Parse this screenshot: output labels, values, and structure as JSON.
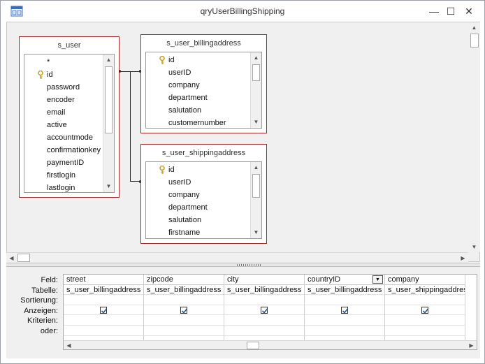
{
  "window": {
    "title": "qryUserBillingShipping",
    "minimize_glyph": "—",
    "maximize_glyph": "☐",
    "close_glyph": "✕"
  },
  "tables": [
    {
      "title": "s_user",
      "fields": [
        {
          "name": "*",
          "key": false
        },
        {
          "name": "id",
          "key": true
        },
        {
          "name": "password",
          "key": false
        },
        {
          "name": "encoder",
          "key": false
        },
        {
          "name": "email",
          "key": false
        },
        {
          "name": "active",
          "key": false
        },
        {
          "name": "accountmode",
          "key": false
        },
        {
          "name": "confirmationkey",
          "key": false
        },
        {
          "name": "paymentID",
          "key": false
        },
        {
          "name": "firstlogin",
          "key": false
        },
        {
          "name": "lastlogin",
          "key": false
        }
      ]
    },
    {
      "title": "s_user_billingaddress",
      "fields": [
        {
          "name": "id",
          "key": true
        },
        {
          "name": "userID",
          "key": false
        },
        {
          "name": "company",
          "key": false
        },
        {
          "name": "department",
          "key": false
        },
        {
          "name": "salutation",
          "key": false
        },
        {
          "name": "customernumber",
          "key": false
        }
      ]
    },
    {
      "title": "s_user_shippingaddress",
      "fields": [
        {
          "name": "id",
          "key": true
        },
        {
          "name": "userID",
          "key": false
        },
        {
          "name": "company",
          "key": false
        },
        {
          "name": "department",
          "key": false
        },
        {
          "name": "salutation",
          "key": false
        },
        {
          "name": "firstname",
          "key": false
        }
      ]
    }
  ],
  "grid": {
    "row_labels": [
      "Feld:",
      "Tabelle:",
      "Sortierung:",
      "Anzeigen:",
      "Kriterien:",
      "oder:"
    ],
    "columns": [
      {
        "feld": "street",
        "tabelle": "s_user_billingaddress",
        "sortierung": "",
        "anzeigen": true,
        "kriterien": "",
        "oder": "",
        "dropdown": false
      },
      {
        "feld": "zipcode",
        "tabelle": "s_user_billingaddress",
        "sortierung": "",
        "anzeigen": true,
        "kriterien": "",
        "oder": "",
        "dropdown": false
      },
      {
        "feld": "city",
        "tabelle": "s_user_billingaddress",
        "sortierung": "",
        "anzeigen": true,
        "kriterien": "",
        "oder": "",
        "dropdown": false
      },
      {
        "feld": "countryID",
        "tabelle": "s_user_billingaddress",
        "sortierung": "",
        "anzeigen": true,
        "kriterien": "",
        "oder": "",
        "dropdown": true
      },
      {
        "feld": "company",
        "tabelle": "s_user_shippingaddress",
        "sortierung": "",
        "anzeigen": true,
        "kriterien": "",
        "oder": "",
        "dropdown": false
      }
    ]
  },
  "icons": {
    "app": "query-design-icon",
    "key": "primary-key-icon",
    "scroll_up": "▲",
    "scroll_down": "▼",
    "scroll_left": "◀",
    "scroll_right": "▶",
    "dropdown": "▼"
  },
  "colors": {
    "table_border": "#a32b2b",
    "key_icon": "#c9a227",
    "checkmark": "#2a5599"
  }
}
